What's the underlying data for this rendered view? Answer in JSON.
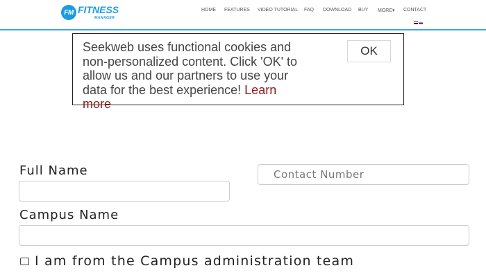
{
  "header": {
    "logo": {
      "badge": "FM",
      "name": "FITNESS",
      "tagline": "MANAGER"
    },
    "nav": [
      {
        "label": "HOME"
      },
      {
        "label": "FEATURES"
      },
      {
        "label": "VIDEO TUTORIAL"
      },
      {
        "label": "FAQ"
      },
      {
        "label": "DOWNLOAD"
      },
      {
        "label": "BUY"
      },
      {
        "label": "MORE▾"
      },
      {
        "label": "CONTACT"
      }
    ],
    "accent_color": "#3da7e0"
  },
  "cookie_banner": {
    "message": "Seekweb uses functional cookies and non-personalized content. Click 'OK' to allow us and our partners to use your data for the best experience!",
    "learn_more": "Learn more",
    "ok_label": "OK"
  },
  "form": {
    "full_name_label": "Full Name",
    "full_name_value": "",
    "contact_number_placeholder": "Contact Number",
    "campus_name_label": "Campus Name",
    "campus_name_value": "",
    "admin_checkbox_label": "I am from the Campus administration team"
  }
}
